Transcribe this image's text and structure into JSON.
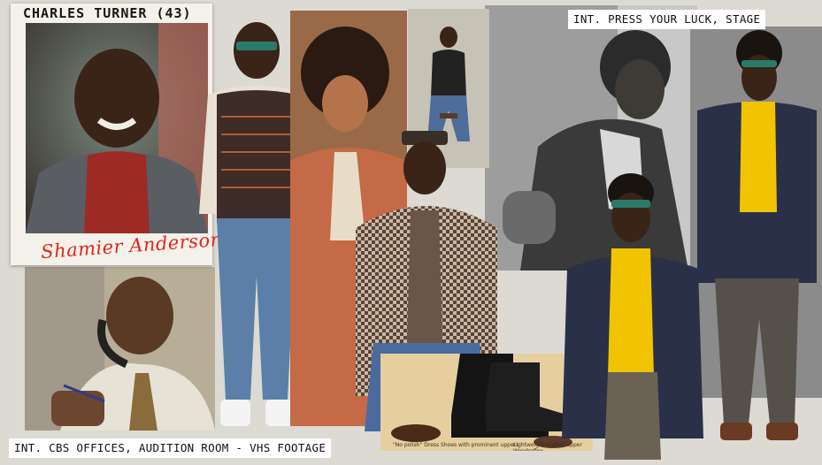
{
  "board": {
    "title": "CHARLES TURNER (43)",
    "actor_signature": "Shamier Anderson",
    "scene_top": "INT. PRESS YOUR LUCK, STAGE",
    "scene_bottom": "INT. CBS OFFICES, AUDITION ROOM - VHS FOOTAGE"
  },
  "ad_captions": {
    "left": "\"No polish\" Dress Shoes with prominent uppers",
    "right": "Lightweight leather upper Wonderflex"
  },
  "colors": {
    "background": "#dcdad3",
    "signature_red": "#e0261f",
    "turtleneck_yellow": "#f2c300",
    "turtleneck_red": "#9e2a26"
  }
}
